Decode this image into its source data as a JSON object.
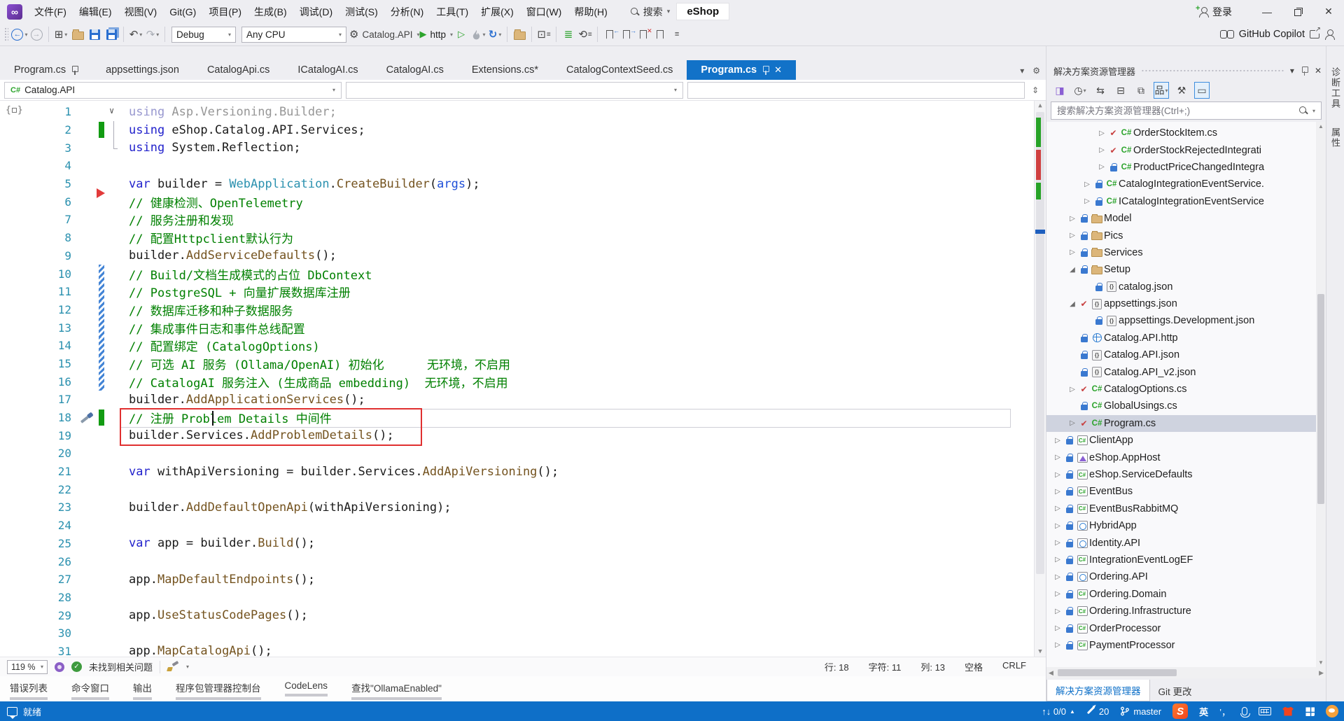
{
  "title_bar": {
    "menus": [
      "文件(F)",
      "编辑(E)",
      "视图(V)",
      "Git(G)",
      "项目(P)",
      "生成(B)",
      "调试(D)",
      "测试(S)",
      "分析(N)",
      "工具(T)",
      "扩展(X)",
      "窗口(W)",
      "帮助(H)"
    ],
    "search_label": "搜索",
    "solution_badge": "eShop",
    "sign_in": "登录"
  },
  "toolbar": {
    "config_dropdown": "Debug",
    "platform_dropdown": "Any CPU",
    "startup_project": "Catalog.API",
    "launch_profile": "http",
    "copilot_label": "GitHub Copilot"
  },
  "editor": {
    "tabs": [
      {
        "label": "Program.cs",
        "pinned": true,
        "active": false
      },
      {
        "label": "appsettings.json",
        "pinned": false,
        "active": false
      },
      {
        "label": "CatalogApi.cs",
        "pinned": false,
        "active": false
      },
      {
        "label": "ICatalogAI.cs",
        "pinned": false,
        "active": false
      },
      {
        "label": "CatalogAI.cs",
        "pinned": false,
        "active": false
      },
      {
        "label": "Extensions.cs*",
        "pinned": false,
        "active": false
      },
      {
        "label": "CatalogContextSeed.cs",
        "pinned": false,
        "active": false
      },
      {
        "label": "Program.cs",
        "pinned": true,
        "active": true
      }
    ],
    "breadcrumb_project": "Catalog.API",
    "zoom_level": "119 %",
    "health_status": "未找到相关问题",
    "caret_info": {
      "line": "行: 18",
      "char": "字符: 11",
      "col": "列: 13",
      "space": "空格",
      "eol": "CRLF"
    },
    "code_lines": [
      {
        "n": 1,
        "m": [
          "chevron"
        ],
        "t": [
          [
            "kwf",
            "using"
          ],
          [
            "plf",
            " Asp.Versioning.Builder;"
          ]
        ]
      },
      {
        "n": 2,
        "m": [
          "green",
          "brk"
        ],
        "t": [
          [
            "kw",
            "using"
          ],
          [
            "pl",
            " eShop.Catalog.API.Services;"
          ]
        ]
      },
      {
        "n": 3,
        "m": [
          "brkend"
        ],
        "t": [
          [
            "kw",
            "using"
          ],
          [
            "pl",
            " System.Reflection;"
          ]
        ]
      },
      {
        "n": 4,
        "m": [],
        "t": []
      },
      {
        "n": 5,
        "m": [
          "bptri"
        ],
        "t": [
          [
            "kw",
            "var"
          ],
          [
            "pl",
            " builder = "
          ],
          [
            "ty",
            "WebApplication"
          ],
          [
            "pl",
            "."
          ],
          [
            "me",
            "CreateBuilder"
          ],
          [
            "pl",
            "("
          ],
          [
            "pa",
            "args"
          ],
          [
            "pl",
            ");"
          ]
        ]
      },
      {
        "n": 6,
        "m": [],
        "t": [
          [
            "cm",
            "// 健康检测、OpenTelemetry"
          ]
        ]
      },
      {
        "n": 7,
        "m": [],
        "t": [
          [
            "cm",
            "// 服务注册和发现"
          ]
        ]
      },
      {
        "n": 8,
        "m": [],
        "t": [
          [
            "cm",
            "// 配置Httpclient默认行为"
          ]
        ]
      },
      {
        "n": 9,
        "m": [],
        "t": [
          [
            "pl",
            "builder."
          ],
          [
            "me",
            "AddServiceDefaults"
          ],
          [
            "pl",
            "();"
          ]
        ]
      },
      {
        "n": 10,
        "m": [
          "hatch"
        ],
        "t": [
          [
            "cm",
            "// Build/文档生成模式的占位 DbContext"
          ]
        ]
      },
      {
        "n": 11,
        "m": [
          "hatch"
        ],
        "t": [
          [
            "cm",
            "// PostgreSQL + 向量扩展数据库注册"
          ]
        ]
      },
      {
        "n": 12,
        "m": [
          "hatch"
        ],
        "t": [
          [
            "cm",
            "// 数据库迁移和种子数据服务"
          ]
        ]
      },
      {
        "n": 13,
        "m": [
          "hatch"
        ],
        "t": [
          [
            "cm",
            "// 集成事件日志和事件总线配置"
          ]
        ]
      },
      {
        "n": 14,
        "m": [
          "hatch"
        ],
        "t": [
          [
            "cm",
            "// 配置绑定 (CatalogOptions)"
          ]
        ]
      },
      {
        "n": 15,
        "m": [
          "hatch"
        ],
        "t": [
          [
            "cm",
            "// 可选 AI 服务 (Ollama/OpenAI) 初始化      无环境，不启用"
          ]
        ]
      },
      {
        "n": 16,
        "m": [
          "hatch"
        ],
        "t": [
          [
            "cm",
            "// CatalogAI 服务注入 (生成商品 embedding)  无环境，不启用"
          ]
        ]
      },
      {
        "n": 17,
        "m": [],
        "t": [
          [
            "pl",
            "builder."
          ],
          [
            "me",
            "AddApplicationServices"
          ],
          [
            "pl",
            "();"
          ]
        ]
      },
      {
        "n": 18,
        "m": [
          "wrench",
          "green"
        ],
        "t": [
          [
            "cm",
            "// 注册 Problem Details 中间件"
          ]
        ]
      },
      {
        "n": 19,
        "m": [],
        "t": [
          [
            "pl",
            "builder.Services."
          ],
          [
            "me",
            "AddProblemDetails"
          ],
          [
            "pl",
            "();"
          ]
        ]
      },
      {
        "n": 20,
        "m": [],
        "t": []
      },
      {
        "n": 21,
        "m": [],
        "t": [
          [
            "kw",
            "var"
          ],
          [
            "pl",
            " withApiVersioning = builder.Services."
          ],
          [
            "me",
            "AddApiVersioning"
          ],
          [
            "pl",
            "();"
          ]
        ]
      },
      {
        "n": 22,
        "m": [],
        "t": []
      },
      {
        "n": 23,
        "m": [],
        "t": [
          [
            "pl",
            "builder."
          ],
          [
            "me",
            "AddDefaultOpenApi"
          ],
          [
            "pl",
            "(withApiVersioning);"
          ]
        ]
      },
      {
        "n": 24,
        "m": [],
        "t": []
      },
      {
        "n": 25,
        "m": [],
        "t": [
          [
            "kw",
            "var"
          ],
          [
            "pl",
            " app = builder."
          ],
          [
            "me",
            "Build"
          ],
          [
            "pl",
            "();"
          ]
        ]
      },
      {
        "n": 26,
        "m": [],
        "t": []
      },
      {
        "n": 27,
        "m": [],
        "t": [
          [
            "pl",
            "app."
          ],
          [
            "me",
            "MapDefaultEndpoints"
          ],
          [
            "pl",
            "();"
          ]
        ]
      },
      {
        "n": 28,
        "m": [],
        "t": []
      },
      {
        "n": 29,
        "m": [],
        "t": [
          [
            "pl",
            "app."
          ],
          [
            "me",
            "UseStatusCodePages"
          ],
          [
            "pl",
            "();"
          ]
        ]
      },
      {
        "n": 30,
        "m": [],
        "t": []
      },
      {
        "n": 31,
        "m": [],
        "t": [
          [
            "pl",
            "app."
          ],
          [
            "me",
            "MapCatalogApi"
          ],
          [
            "pl",
            "();"
          ]
        ]
      }
    ]
  },
  "bottom_panel_tabs": [
    "错误列表",
    "命令窗口",
    "输出",
    "程序包管理器控制台",
    "CodeLens",
    "查找\"OllamaEnabled\""
  ],
  "solution_explorer": {
    "title": "解决方案资源管理器",
    "search_placeholder": "搜索解决方案资源管理器(Ctrl+;)",
    "items": [
      {
        "indent": 3,
        "exp": "c",
        "badge": "check",
        "icon": "cs",
        "label": "OrderStockItem.cs"
      },
      {
        "indent": 3,
        "exp": "c",
        "badge": "check",
        "icon": "cs",
        "label": "OrderStockRejectedIntegrati"
      },
      {
        "indent": 3,
        "exp": "c",
        "badge": "lock",
        "icon": "cs",
        "label": "ProductPriceChangedIntegra"
      },
      {
        "indent": 2,
        "exp": "c",
        "badge": "lock",
        "icon": "cs",
        "label": "CatalogIntegrationEventService."
      },
      {
        "indent": 2,
        "exp": "c",
        "badge": "lock",
        "icon": "cs",
        "label": "ICatalogIntegrationEventService"
      },
      {
        "indent": 1,
        "exp": "c",
        "badge": "lock",
        "icon": "folder",
        "label": "Model"
      },
      {
        "indent": 1,
        "exp": "c",
        "badge": "lock",
        "icon": "folder",
        "label": "Pics"
      },
      {
        "indent": 1,
        "exp": "c",
        "badge": "lock",
        "icon": "folder",
        "label": "Services"
      },
      {
        "indent": 1,
        "exp": "e",
        "badge": "lock",
        "icon": "folder",
        "label": "Setup"
      },
      {
        "indent": 2,
        "exp": "",
        "badge": "lock",
        "icon": "json",
        "label": "catalog.json"
      },
      {
        "indent": 1,
        "exp": "e",
        "badge": "check",
        "icon": "json",
        "label": "appsettings.json"
      },
      {
        "indent": 2,
        "exp": "",
        "badge": "lock",
        "icon": "json",
        "label": "appsettings.Development.json"
      },
      {
        "indent": 1,
        "exp": "",
        "badge": "lock",
        "icon": "globe",
        "label": "Catalog.API.http"
      },
      {
        "indent": 1,
        "exp": "",
        "badge": "lock",
        "icon": "json",
        "label": "Catalog.API.json"
      },
      {
        "indent": 1,
        "exp": "",
        "badge": "lock",
        "icon": "json",
        "label": "Catalog.API_v2.json"
      },
      {
        "indent": 1,
        "exp": "c",
        "badge": "check",
        "icon": "cs",
        "label": "CatalogOptions.cs"
      },
      {
        "indent": 1,
        "exp": "",
        "badge": "lock",
        "icon": "cs",
        "label": "GlobalUsings.cs"
      },
      {
        "indent": 1,
        "exp": "c",
        "badge": "check",
        "icon": "cs",
        "label": "Program.cs",
        "selected": true
      },
      {
        "indent": 0,
        "exp": "c",
        "badge": "lock",
        "icon": "csproj",
        "label": "ClientApp"
      },
      {
        "indent": 0,
        "exp": "c",
        "badge": "lock",
        "icon": "apphost",
        "label": "eShop.AppHost"
      },
      {
        "indent": 0,
        "exp": "c",
        "badge": "lock",
        "icon": "csproj",
        "label": "eShop.ServiceDefaults"
      },
      {
        "indent": 0,
        "exp": "c",
        "badge": "lock",
        "icon": "csproj",
        "label": "EventBus"
      },
      {
        "indent": 0,
        "exp": "c",
        "badge": "lock",
        "icon": "csproj",
        "label": "EventBusRabbitMQ"
      },
      {
        "indent": 0,
        "exp": "c",
        "badge": "lock",
        "icon": "web",
        "label": "HybridApp"
      },
      {
        "indent": 0,
        "exp": "c",
        "badge": "lock",
        "icon": "web",
        "label": "Identity.API"
      },
      {
        "indent": 0,
        "exp": "c",
        "badge": "lock",
        "icon": "csproj",
        "label": "IntegrationEventLogEF"
      },
      {
        "indent": 0,
        "exp": "c",
        "badge": "lock",
        "icon": "web",
        "label": "Ordering.API"
      },
      {
        "indent": 0,
        "exp": "c",
        "badge": "lock",
        "icon": "csproj",
        "label": "Ordering.Domain"
      },
      {
        "indent": 0,
        "exp": "c",
        "badge": "lock",
        "icon": "csproj",
        "label": "Ordering.Infrastructure"
      },
      {
        "indent": 0,
        "exp": "c",
        "badge": "lock",
        "icon": "csproj",
        "label": "OrderProcessor"
      },
      {
        "indent": 0,
        "exp": "c",
        "badge": "lock",
        "icon": "csproj",
        "label": "PaymentProcessor"
      }
    ],
    "bottom_tabs": [
      {
        "label": "解决方案资源管理器",
        "active": true
      },
      {
        "label": "Git 更改",
        "active": false
      }
    ]
  },
  "side_strip_tabs": [
    "诊断工具",
    "属性"
  ],
  "status_bar": {
    "ready": "就绪",
    "sync_counts": "↑↓ 0/0",
    "pending_edits": "20",
    "branch": "master",
    "ime_mode": "英",
    "ime_punct": "’，"
  },
  "colors": {
    "accent": "#1272C8",
    "status_bar": "#0E6FC8",
    "comment": "#008000",
    "keyword": "#2222CC",
    "type": "#2B91AF",
    "method": "#74531F"
  }
}
